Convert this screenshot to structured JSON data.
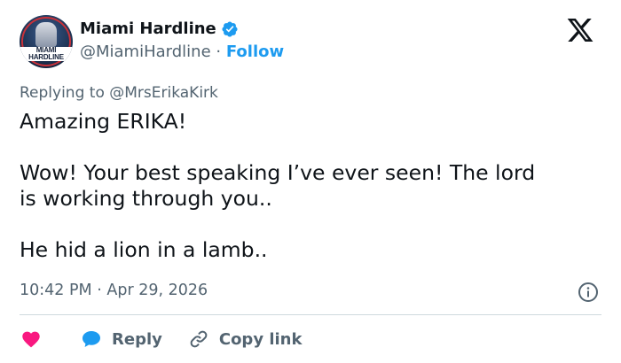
{
  "author": {
    "name": "Miami Hardline",
    "handle": "@MiamiHardline",
    "follow_label": "Follow",
    "separator": "·",
    "avatar_text": "MIAMI HARDLINE"
  },
  "replying": {
    "prefix": "Replying to",
    "mention": "@MrsErikaKirk"
  },
  "tweet": {
    "line1": "Amazing ERIKA!",
    "line2": "Wow! Your best speaking I’ve ever seen! The lord",
    "line3": "is working through you..",
    "line4": "He hid a lion in a lamb.."
  },
  "meta": {
    "time": "10:42 PM",
    "separator": "·",
    "date": "Apr 29, 2026"
  },
  "actions": {
    "reply_label": "Reply",
    "copy_link_label": "Copy link"
  },
  "colors": {
    "accent": "#1d9bf0",
    "like": "#f91880",
    "text": "#0f1419",
    "muted": "#536471",
    "divider": "#cfd9de"
  },
  "icons": [
    "verified-badge-icon",
    "x-logo-icon",
    "info-icon",
    "heart-icon",
    "reply-bubble-icon",
    "link-icon"
  ]
}
